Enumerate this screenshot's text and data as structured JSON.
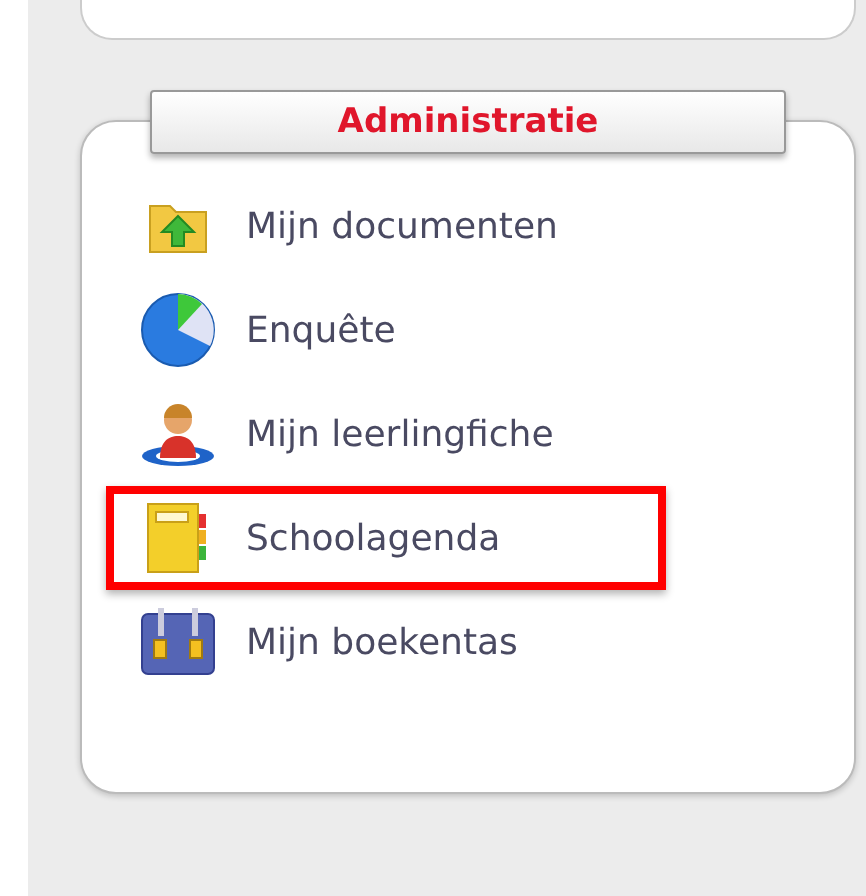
{
  "panel": {
    "title": "Administratie",
    "items": [
      {
        "kind": "folder",
        "label": "Mijn documenten",
        "selected": false
      },
      {
        "kind": "pie",
        "label": "Enquête",
        "selected": false
      },
      {
        "kind": "person",
        "label": "Mijn leerlingfiche",
        "selected": false
      },
      {
        "kind": "agenda",
        "label": "Schoolagenda",
        "selected": true
      },
      {
        "kind": "bag",
        "label": "Mijn boekentas",
        "selected": false
      }
    ]
  }
}
